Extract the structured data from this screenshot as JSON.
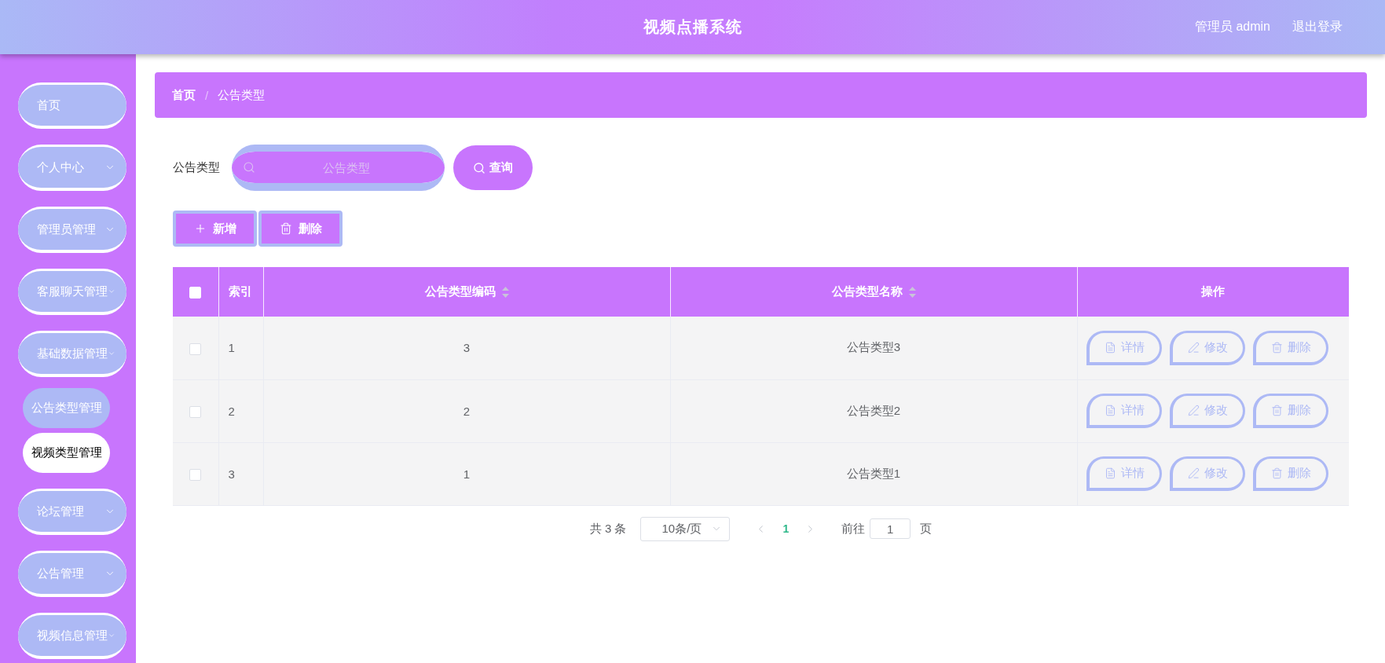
{
  "header": {
    "title": "视频点播系统",
    "user": "管理员 admin",
    "logout": "退出登录"
  },
  "sidebar": {
    "items": [
      {
        "label": "首页",
        "kind": "link"
      },
      {
        "label": "个人中心",
        "kind": "submenu"
      },
      {
        "label": "管理员管理",
        "kind": "submenu"
      },
      {
        "label": "客服聊天管理",
        "kind": "submenu"
      },
      {
        "label": "基础数据管理",
        "kind": "submenu",
        "children": [
          {
            "label": "公告类型管理",
            "selected": false
          },
          {
            "label": "视频类型管理",
            "selected": true
          }
        ]
      },
      {
        "label": "论坛管理",
        "kind": "submenu"
      },
      {
        "label": "公告管理",
        "kind": "submenu"
      },
      {
        "label": "视频信息管理",
        "kind": "submenu"
      }
    ]
  },
  "breadcrumb": {
    "items": [
      "首页",
      "公告类型"
    ],
    "separator": "/"
  },
  "search": {
    "label": "公告类型",
    "placeholder": "公告类型",
    "button": "查询"
  },
  "toolbar": [
    {
      "kind": "add",
      "label": "新增"
    },
    {
      "kind": "delete",
      "label": "删除"
    }
  ],
  "table": {
    "select_all_checked": false,
    "columns": [
      {
        "label": "索引",
        "sortable": false
      },
      {
        "label": "公告类型编码",
        "sortable": true
      },
      {
        "label": "公告类型名称",
        "sortable": true
      },
      {
        "label": "操作",
        "sortable": false
      }
    ],
    "rows": [
      {
        "checked": false,
        "cells": [
          "1",
          "3",
          "公告类型3"
        ],
        "actions": [
          {
            "kind": "detail",
            "label": "详情"
          },
          {
            "kind": "edit",
            "label": "修改"
          },
          {
            "kind": "delete",
            "label": "删除"
          }
        ]
      },
      {
        "checked": false,
        "cells": [
          "2",
          "2",
          "公告类型2"
        ],
        "actions": [
          {
            "kind": "detail",
            "label": "详情"
          },
          {
            "kind": "edit",
            "label": "修改"
          },
          {
            "kind": "delete",
            "label": "删除"
          }
        ]
      },
      {
        "checked": false,
        "cells": [
          "3",
          "1",
          "公告类型1"
        ],
        "actions": [
          {
            "kind": "detail",
            "label": "详情"
          },
          {
            "kind": "edit",
            "label": "修改"
          },
          {
            "kind": "delete",
            "label": "删除"
          }
        ]
      }
    ]
  },
  "pagination": {
    "total": "共 3 条",
    "page_size": "10条/页",
    "pages": [
      {
        "label": "1",
        "selected": true
      }
    ],
    "goto_label": "前往",
    "goto_value": "1",
    "goto_suffix": "页"
  }
}
